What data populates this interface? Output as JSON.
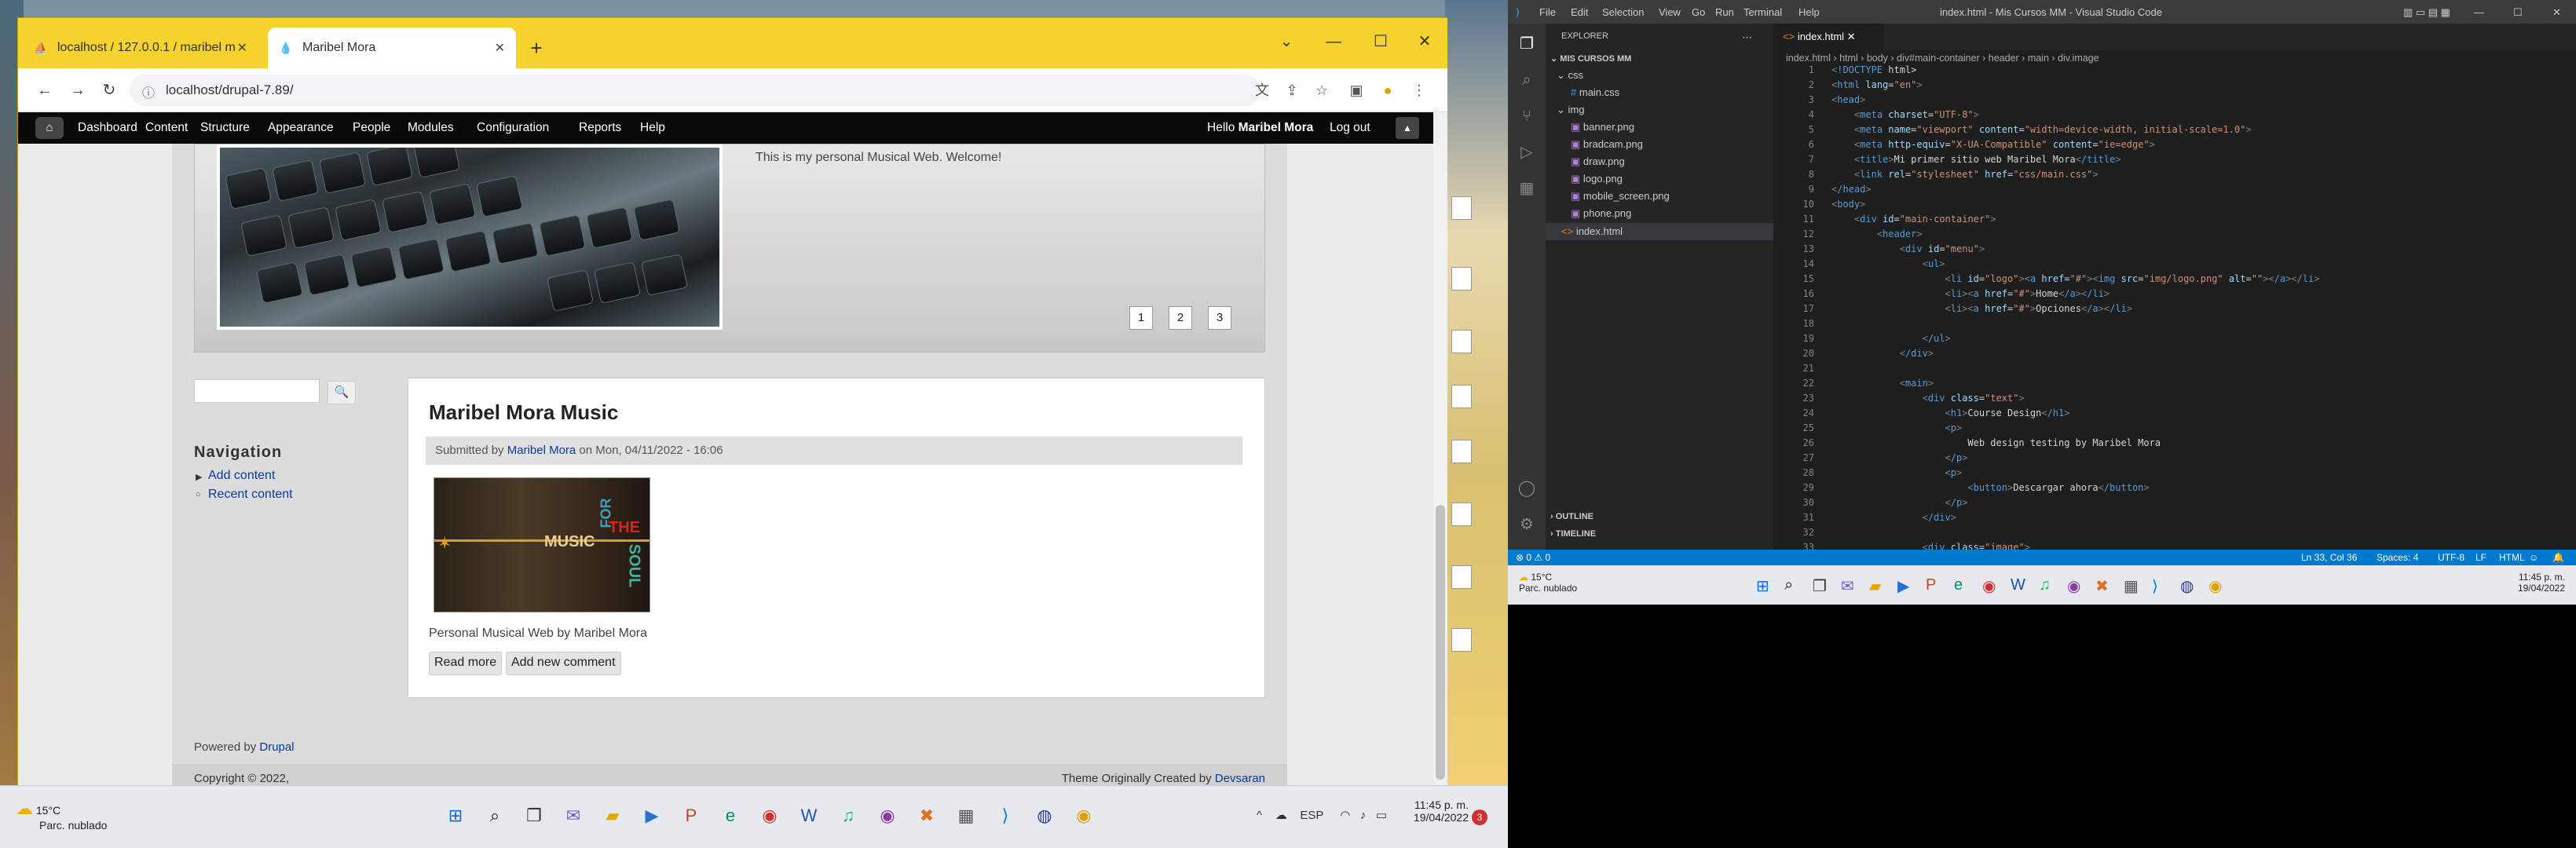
{
  "browser": {
    "tabs": [
      {
        "label": "localhost / 127.0.0.1 / maribel m",
        "icon": "phpmyadmin-icon"
      },
      {
        "label": "Maribel Mora",
        "icon": "drupal-icon",
        "active": true
      }
    ],
    "url": "localhost/drupal-7.89/"
  },
  "drupal_toolbar": {
    "items": [
      "Dashboard",
      "Content",
      "Structure",
      "Appearance",
      "People",
      "Modules",
      "Configuration",
      "Reports",
      "Help"
    ],
    "greeting": "Hello",
    "user": "Maribel Mora",
    "logout": "Log out"
  },
  "slider": {
    "welcome": "This is my personal Musical Web. Welcome!",
    "pages": [
      "1",
      "2",
      "3"
    ]
  },
  "sidebar": {
    "nav_title": "Navigation",
    "links": [
      "Add content",
      "Recent content"
    ]
  },
  "article": {
    "title": "Maribel Mora Music",
    "submitted_prefix": "Submitted by",
    "author": "Maribel Mora",
    "submitted_suffix": "on Mon, 04/11/2022 - 16:06",
    "image_words": [
      "MUSIC",
      "FOR",
      "THE",
      "SOUL"
    ],
    "caption": "Personal Musical Web by Maribel Mora",
    "read_more": "Read more",
    "add_comment": "Add new comment"
  },
  "footer": {
    "powered_prefix": "Powered by",
    "powered_link": "Drupal",
    "copyright": "Copyright © 2022,",
    "theme_prefix": "Theme Originally Created by",
    "theme_link": "Devsaran"
  },
  "taskbar_left": {
    "temp": "15°C",
    "weather": "Parc. nublado",
    "lang": "ESP",
    "time": "11:45 p. m.",
    "date": "19/04/2022"
  },
  "vscode": {
    "menu": [
      "File",
      "Edit",
      "Selection",
      "View",
      "Go",
      "Run",
      "Terminal",
      "Help"
    ],
    "window_title": "index.html - Mis Cursos MM - Visual Studio Code",
    "explorer_title": "EXPLORER",
    "folder": "MIS CURSOS MM",
    "tree": [
      {
        "name": "css",
        "depth": 1,
        "kind": "folder"
      },
      {
        "name": "main.css",
        "depth": 2,
        "kind": "css"
      },
      {
        "name": "img",
        "depth": 1,
        "kind": "folder"
      },
      {
        "name": "banner.png",
        "depth": 2,
        "kind": "img"
      },
      {
        "name": "bradcam.png",
        "depth": 2,
        "kind": "img"
      },
      {
        "name": "draw.png",
        "depth": 2,
        "kind": "img"
      },
      {
        "name": "logo.png",
        "depth": 2,
        "kind": "img"
      },
      {
        "name": "mobile_screen.png",
        "depth": 2,
        "kind": "img"
      },
      {
        "name": "phone.png",
        "depth": 2,
        "kind": "img"
      },
      {
        "name": "index.html",
        "depth": 1,
        "kind": "html"
      }
    ],
    "outline": "OUTLINE",
    "timeline": "TIMELINE",
    "tab": "index.html",
    "breadcrumb": [
      "index.html",
      "html",
      "body",
      "div#main-container",
      "header",
      "main",
      "div.image"
    ],
    "code": [
      [
        "1",
        "<!DOCTYPE html>"
      ],
      [
        "2",
        "<html lang=\"en\">"
      ],
      [
        "3",
        "<head>"
      ],
      [
        "4",
        "    <meta charset=\"UTF-8\">"
      ],
      [
        "5",
        "    <meta name=\"viewport\" content=\"width=device-width, initial-scale=1.0\">"
      ],
      [
        "6",
        "    <meta http-equiv=\"X-UA-Compatible\" content=\"ie=edge\">"
      ],
      [
        "7",
        "    <title>Mi primer sitio web Maribel Mora</title>"
      ],
      [
        "8",
        "    <link rel=\"stylesheet\" href=\"css/main.css\">"
      ],
      [
        "9",
        "</head>"
      ],
      [
        "10",
        "<body>"
      ],
      [
        "11",
        "    <div id=\"main-container\">"
      ],
      [
        "12",
        "        <header>"
      ],
      [
        "13",
        "            <div id=\"menu\">"
      ],
      [
        "14",
        "                <ul>"
      ],
      [
        "15",
        "                    <li id=\"logo\"><a href=\"#\"><img src=\"img/logo.png\" alt=\"\"></a></li>"
      ],
      [
        "16",
        "                    <li><a href=\"#\">Home</a></li>"
      ],
      [
        "17",
        "                    <li><a href=\"#\">Opciones</a></li>"
      ],
      [
        "18",
        ""
      ],
      [
        "19",
        "                </ul>"
      ],
      [
        "20",
        "            </div>"
      ],
      [
        "21",
        ""
      ],
      [
        "22",
        "            <main>"
      ],
      [
        "23",
        "                <div class=\"text\">"
      ],
      [
        "24",
        "                    <h1>Course Design</h1>"
      ],
      [
        "25",
        "                    <p>"
      ],
      [
        "26",
        "                        Web design testing by Maribel Mora"
      ],
      [
        "27",
        "                    </p>"
      ],
      [
        "28",
        "                    <p>"
      ],
      [
        "29",
        "                        <button>Descargar ahora</button>"
      ],
      [
        "30",
        "                    </p>"
      ],
      [
        "31",
        "                </div>"
      ],
      [
        "32",
        ""
      ],
      [
        "33",
        "                <div class=\"image\">"
      ]
    ],
    "status": {
      "errors": "0",
      "warnings": "0",
      "position": "Ln 33, Col 36",
      "spaces": "Spaces: 4",
      "encoding": "UTF-8",
      "eol": "LF",
      "lang": "HTML"
    }
  },
  "taskbar_right": {
    "temp": "15°C",
    "weather": "Parc. nublado",
    "time": "11:45 p. m.",
    "date": "19/04/2022"
  }
}
